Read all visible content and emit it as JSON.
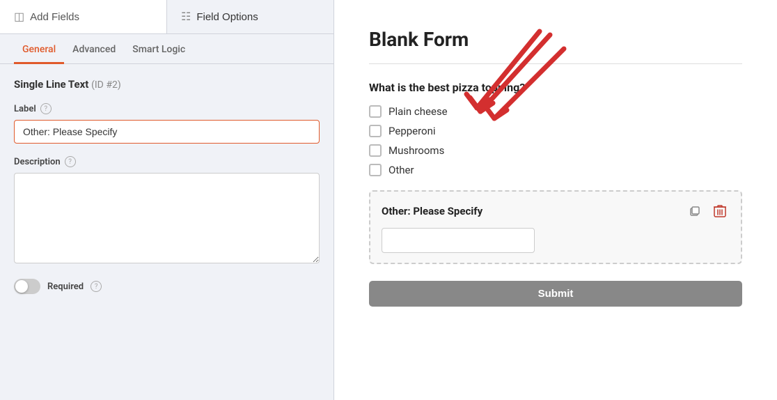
{
  "header": {
    "add_fields_label": "Add Fields",
    "field_options_label": "Field Options",
    "add_fields_icon": "table-icon",
    "field_options_icon": "sliders-icon"
  },
  "inner_tabs": [
    {
      "id": "general",
      "label": "General",
      "active": true
    },
    {
      "id": "advanced",
      "label": "Advanced",
      "active": false
    },
    {
      "id": "smart_logic",
      "label": "Smart Logic",
      "active": false
    }
  ],
  "field_options": {
    "field_title": "Single Line Text",
    "field_id": "(ID #2)",
    "label_text": "Label",
    "label_value": "Other: Please Specify",
    "description_text": "Description",
    "description_value": "",
    "required_text": "Required",
    "required_active": false
  },
  "form": {
    "title": "Blank Form",
    "question": "What is the best pizza topping?",
    "options": [
      {
        "label": "Plain cheese"
      },
      {
        "label": "Pepperoni"
      },
      {
        "label": "Mushrooms"
      },
      {
        "label": "Other"
      }
    ],
    "other_field_title": "Other: Please Specify",
    "submit_label": "Submit"
  },
  "help_tooltip": "?",
  "colors": {
    "accent": "#e05a2b",
    "delete_red": "#c0392b"
  }
}
